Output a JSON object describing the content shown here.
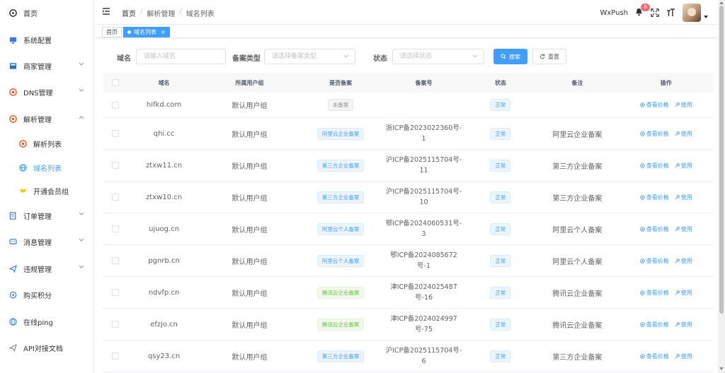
{
  "sidebar": {
    "items": [
      {
        "label": "首页",
        "icon": "dashboard-icon"
      },
      {
        "label": "系统配置",
        "icon": "monitor-icon"
      },
      {
        "label": "商家管理",
        "icon": "merchant-icon"
      },
      {
        "label": "DNS管理",
        "icon": "dns-icon"
      },
      {
        "label": "解析管理",
        "icon": "resolve-icon"
      },
      {
        "label": "解析列表",
        "icon": "resolve-list-icon"
      },
      {
        "label": "域名列表",
        "icon": "globe-icon"
      },
      {
        "label": "开通会员组",
        "icon": "member-icon"
      },
      {
        "label": "订单管理",
        "icon": "order-icon"
      },
      {
        "label": "消息管理",
        "icon": "message-icon"
      },
      {
        "label": "违规管理",
        "icon": "send-icon"
      },
      {
        "label": "购买积分",
        "icon": "points-icon"
      },
      {
        "label": "在线ping",
        "icon": "ping-icon"
      },
      {
        "label": "API对接文档",
        "icon": "api-doc-icon"
      }
    ]
  },
  "header": {
    "breadcrumb": [
      "首页",
      "解析管理",
      "域名列表"
    ],
    "wxpush": "WxPush",
    "notification_count": "0"
  },
  "tags": {
    "home": "首页",
    "active": "域名列表",
    "close": "×"
  },
  "search": {
    "domain_label": "域名",
    "domain_placeholder": "请输入域名",
    "type_label": "备案类型",
    "type_placeholder": "请选择备案类型",
    "status_label": "状态",
    "status_placeholder": "请选择状态",
    "search_button": "搜索",
    "reset_button": "重置"
  },
  "table": {
    "columns": [
      "域名",
      "所属用户组",
      "是否备案",
      "备案号",
      "状态",
      "备注",
      "操作"
    ],
    "op_price": "查看价格",
    "op_use": "使用",
    "rows": [
      {
        "domain": "hifkd.com",
        "group": "默认用户组",
        "filing": "未备案",
        "filing_style": "info",
        "icp1": "",
        "icp2": "",
        "status": "正常",
        "note": ""
      },
      {
        "domain": "qhi.cc",
        "group": "默认用户组",
        "filing": "阿里云企业备案",
        "filing_style": "primary",
        "icp1": "浙ICP备2023022360号-",
        "icp2": "1",
        "status": "正常",
        "note": "阿里云企业备案"
      },
      {
        "domain": "ztxw11.cn",
        "group": "默认用户组",
        "filing": "第三方企业备案",
        "filing_style": "primary",
        "icp1": "沪ICP备2025115704号-",
        "icp2": "11",
        "status": "正常",
        "note": "第三方企业备案"
      },
      {
        "domain": "ztxw10.cn",
        "group": "默认用户组",
        "filing": "第三方企业备案",
        "filing_style": "primary",
        "icp1": "沪ICP备2025115704号-",
        "icp2": "10",
        "status": "正常",
        "note": "第三方企业备案"
      },
      {
        "domain": "ujuog.cn",
        "group": "默认用户组",
        "filing": "阿里云个人备案",
        "filing_style": "primary",
        "icp1": "鄂ICP备2024060531号-",
        "icp2": "3",
        "status": "正常",
        "note": "阿里云个人备案"
      },
      {
        "domain": "pgnrb.cn",
        "group": "默认用户组",
        "filing": "阿里云个人备案",
        "filing_style": "primary",
        "icp1": "鄂ICP备2024085672",
        "icp2": "号-1",
        "status": "正常",
        "note": "阿里云个人备案"
      },
      {
        "domain": "ndvfp.cn",
        "group": "默认用户组",
        "filing": "腾讯云企业备案",
        "filing_style": "success",
        "icp1": "津ICP备2024025487",
        "icp2": "号-16",
        "status": "正常",
        "note": "腾讯云企业备案"
      },
      {
        "domain": "efzjo.cn",
        "group": "默认用户组",
        "filing": "腾讯云企业备案",
        "filing_style": "success",
        "icp1": "津ICP备2024024997",
        "icp2": "号-75",
        "status": "正常",
        "note": "腾讯云企业备案"
      },
      {
        "domain": "qsy23.cn",
        "group": "默认用户组",
        "filing": "第三方企业备案",
        "filing_style": "primary",
        "icp1": "沪ICP备2025115704号-",
        "icp2": "6",
        "status": "正常",
        "note": "第三方企业备案"
      }
    ]
  },
  "colors": {
    "accent": "#409eff",
    "success": "#67c23a",
    "danger": "#f56c6c"
  }
}
